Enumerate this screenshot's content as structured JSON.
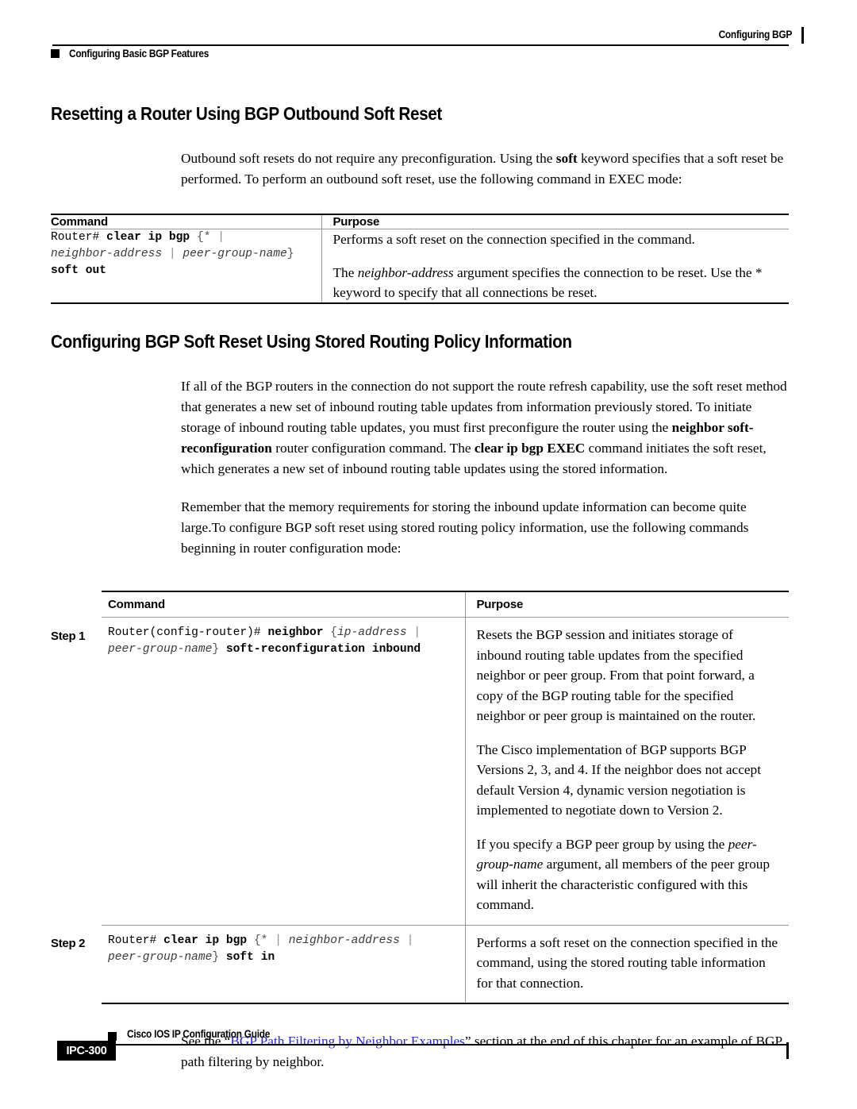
{
  "header": {
    "left_label": "Configuring Basic BGP Features",
    "right_label": "Configuring BGP"
  },
  "sections": [
    {
      "title": "Resetting a Router Using BGP Outbound Soft Reset",
      "intro_lead": "Outbound soft resets do not require any preconfiguration. Using the ",
      "intro_bold": "soft",
      "intro_tail": " keyword specifies that a soft reset be performed. To perform an outbound soft reset, use the following command in EXEC mode:"
    },
    {
      "title": "Configuring BGP Soft Reset Using Stored Routing Policy Information"
    }
  ],
  "table1": {
    "col_command": "Command",
    "col_purpose": "Purpose",
    "row": {
      "command": {
        "prompt": "Router#",
        "keyword": "clear ip bgp",
        "open_brace": "{*",
        "pipe": "|",
        "arg1": "neighbor-address",
        "pipe2": "|",
        "arg2": "peer-group-name",
        "close_brace": "}",
        "keyword2": "soft out"
      },
      "purpose": [
        "Performs a soft reset on the connection specified in the command.",
        "The neighbor-address argument specifies the connection to be reset. Use the * keyword to specify that all connections be reset."
      ],
      "purpose_p2_lead": "The ",
      "purpose_p2_ital": "neighbor-address",
      "purpose_p2_tail": " argument specifies the connection to be reset. Use the * keyword to specify that all connections be reset."
    }
  },
  "paragraphs": {
    "p1_a": "If all of the BGP routers in the connection do not support the route refresh capability, use the soft reset method that generates a new set of inbound routing table updates from information previously stored. To initiate storage of inbound routing table updates, you must first preconfigure the router using the ",
    "p1_b1": "neighbor soft-reconfiguration",
    "p1_c": " router configuration command. The ",
    "p1_b2": "clear ip bgp EXEC",
    "p1_d": " command initiates the soft reset, which generates a new set of inbound routing table updates using the stored information.",
    "p2": "Remember that the memory requirements for storing the inbound update information can become quite large.To configure BGP soft reset using stored routing policy information, use the following commands beginning in router configuration mode:"
  },
  "table2": {
    "col_command": "Command",
    "col_purpose": "Purpose",
    "rows": [
      {
        "step": "Step 1",
        "command": {
          "prompt": "Router(config-router)#",
          "keyword": "neighbor",
          "open_brace": "{",
          "arg1": "ip-address",
          "pipe": "|",
          "arg2": "peer-group-name",
          "close_brace": "}",
          "keyword2": "soft-reconfiguration inbound"
        },
        "purpose": [
          "Resets the BGP session and initiates storage of inbound routing table updates from the specified neighbor or peer group. From that point forward, a copy of the BGP routing table for the specified neighbor or peer group is maintained on the router.",
          "The Cisco implementation of BGP supports BGP Versions 2, 3, and 4. If the neighbor does not accept default Version 4, dynamic version negotiation is implemented to negotiate down to Version 2."
        ],
        "purpose_p3_lead": "If you specify a BGP peer group by using the ",
        "purpose_p3_ital": "peer-group-name",
        "purpose_p3_tail": " argument, all members of the peer group will inherit the characteristic configured with this command."
      },
      {
        "step": "Step 2",
        "command": {
          "prompt": "Router#",
          "keyword": "clear ip bgp",
          "open_brace": "{*",
          "pipe": "|",
          "arg1": "neighbor-address",
          "pipe2": "|",
          "arg2": "peer-group-name",
          "close_brace": "}",
          "keyword2": "soft in"
        },
        "purpose": [
          "Performs a soft reset on the connection specified in the command, using the stored routing table information for that connection."
        ]
      }
    ]
  },
  "closing": {
    "lead": "See the “",
    "link": "BGP Path Filtering by Neighbor Examples",
    "tail": "” section at the end of this chapter for an example of BGP path filtering by neighbor."
  },
  "footer": {
    "guide_title": "Cisco IOS IP Configuration Guide",
    "page_number": "IPC-300"
  },
  "colors": {
    "link": "#2727e8",
    "rule": "#000000",
    "thin_rule": "#999999"
  }
}
